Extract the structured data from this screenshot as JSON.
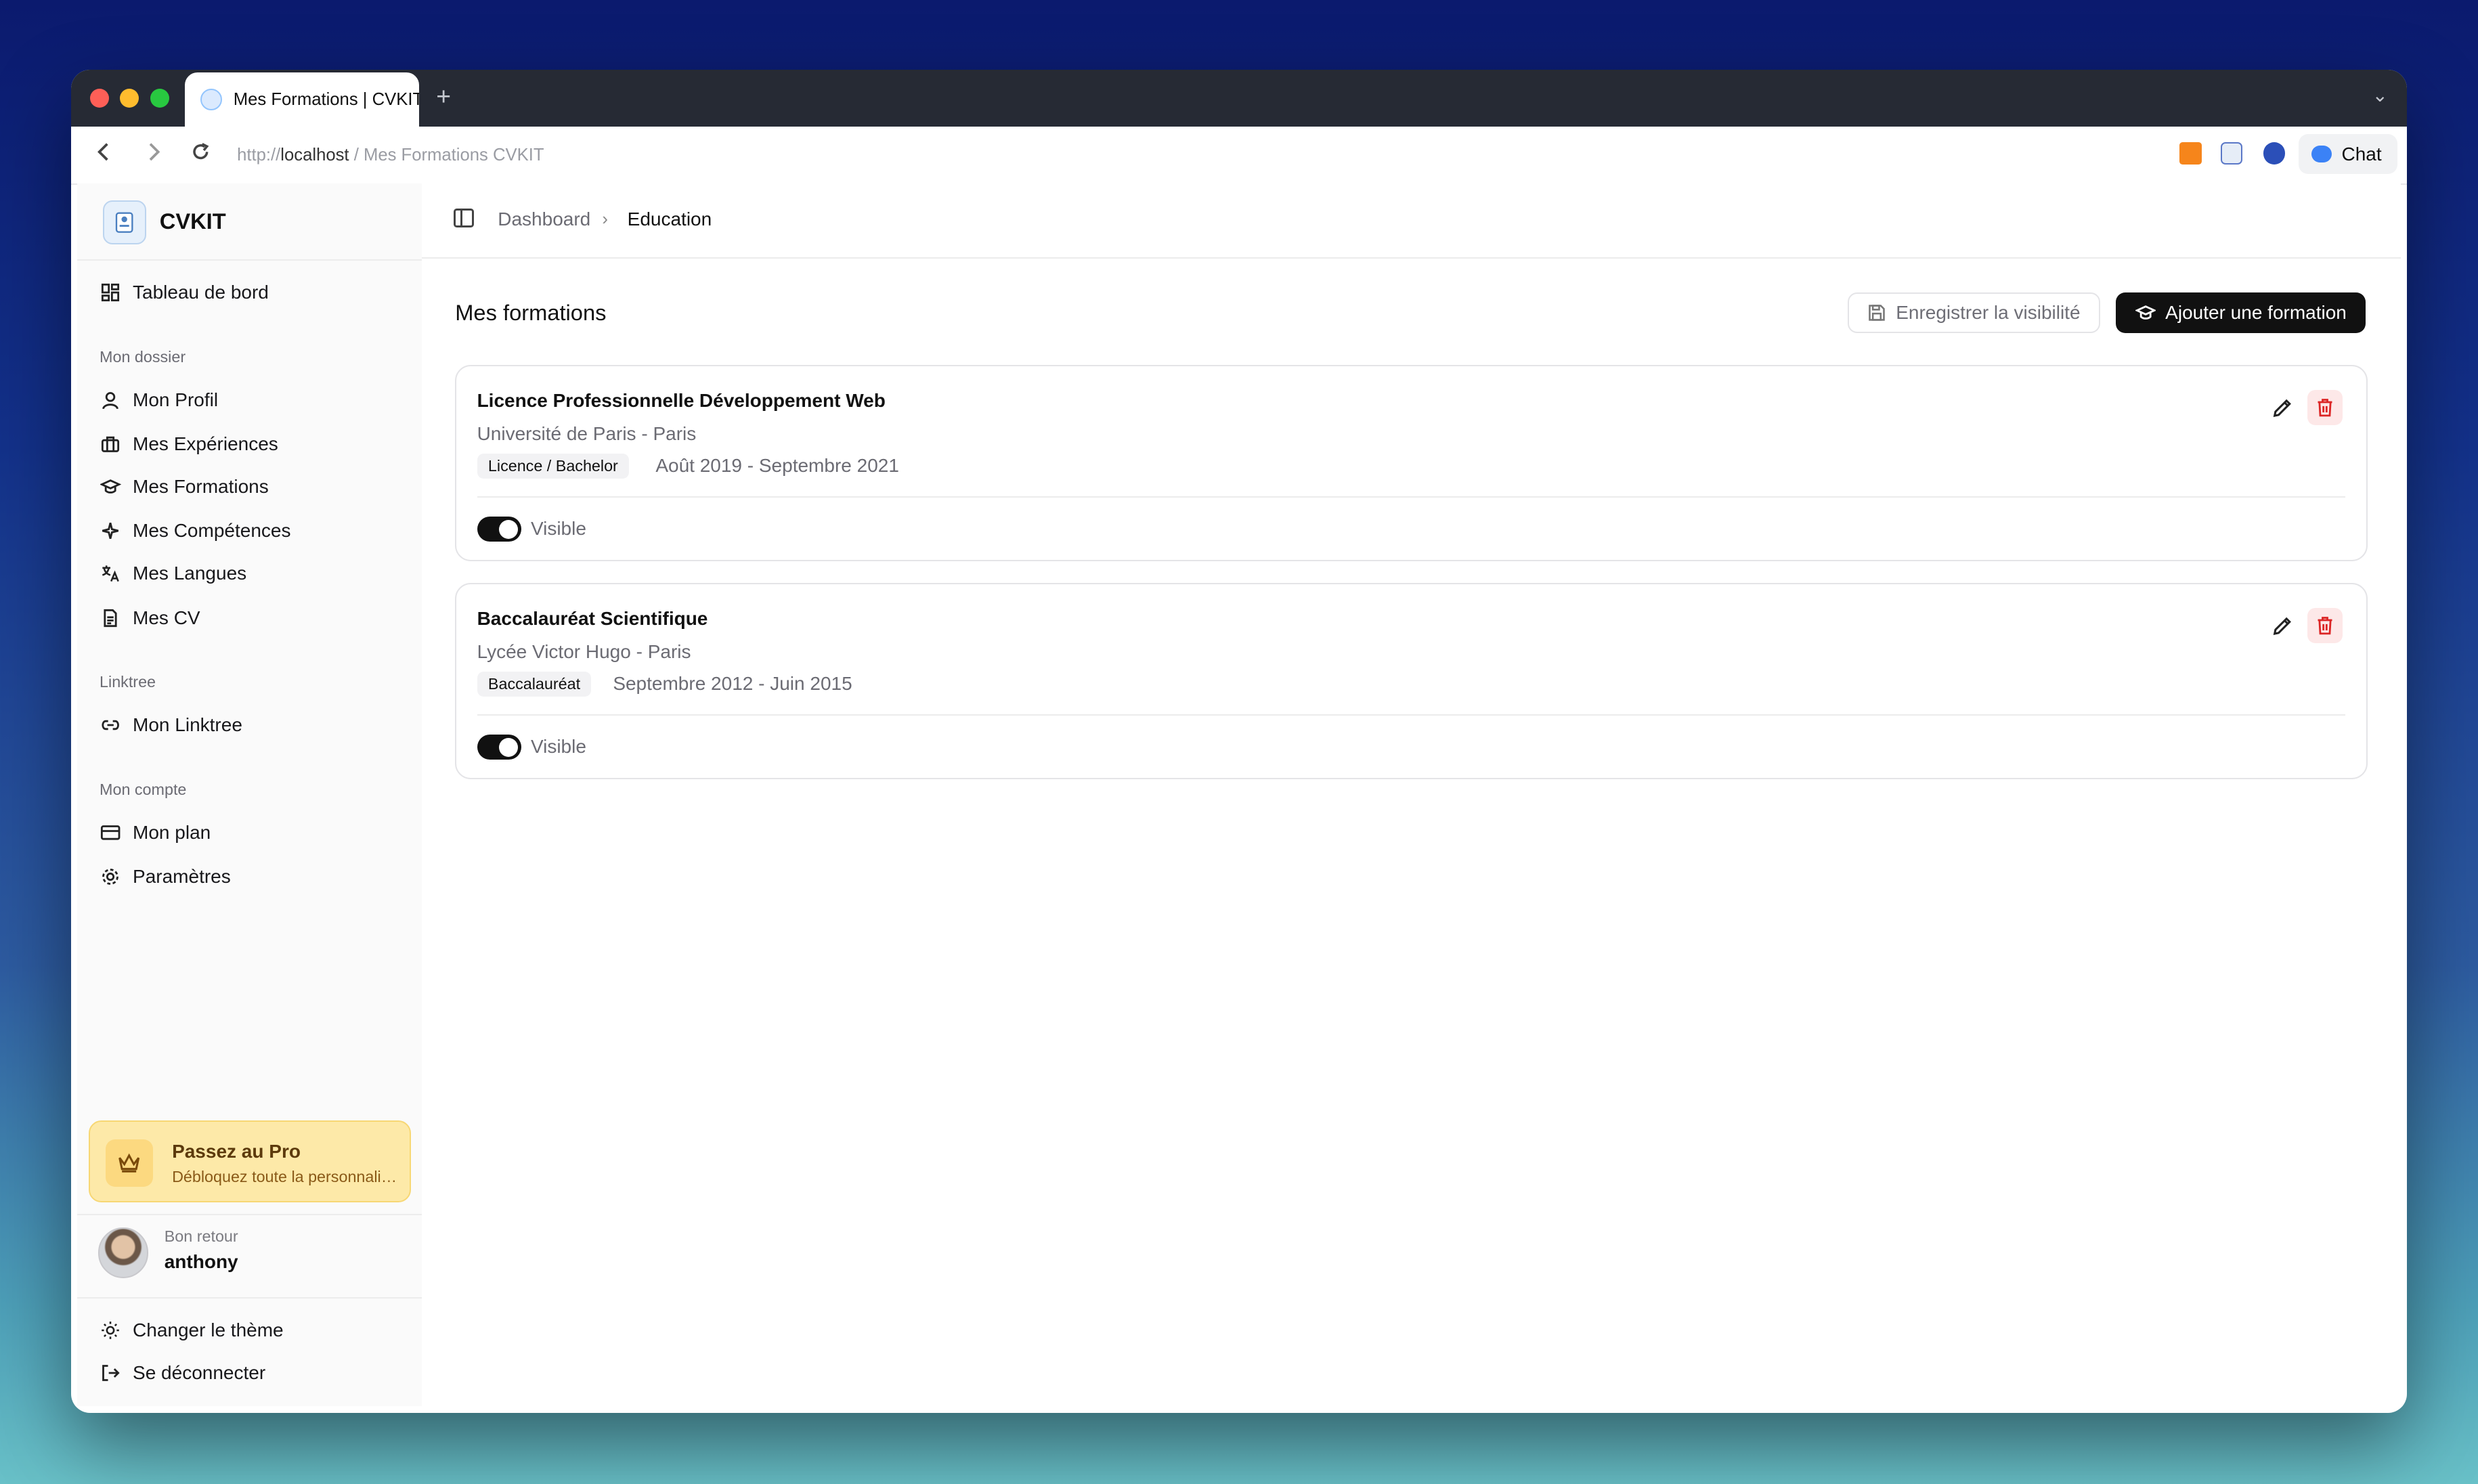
{
  "browser": {
    "tab_title": "Mes Formations | CVKIT",
    "url_scheme": "http://",
    "url_host": "localhost",
    "url_rest": " / Mes Formations CVKIT",
    "chat_label": "Chat"
  },
  "sidebar": {
    "brand": "CVKIT",
    "dashboard": "Tableau de bord",
    "section_dossier": "Mon dossier",
    "profil": "Mon Profil",
    "experiences": "Mes Expériences",
    "formations": "Mes Formations",
    "competences": "Mes Compétences",
    "langues": "Mes Langues",
    "cv": "Mes CV",
    "section_linktree": "Linktree",
    "linktree": "Mon Linktree",
    "section_compte": "Mon compte",
    "plan": "Mon plan",
    "parametres": "Paramètres",
    "promo_title": "Passez au Pro",
    "promo_text": "Débloquez toute la personnalisation",
    "user_greeting": "Bon retour",
    "user_name": "anthony",
    "theme": "Changer le thème",
    "logout": "Se déconnecter"
  },
  "breadcrumb": {
    "parent": "Dashboard",
    "current": "Education"
  },
  "main": {
    "title": "Mes formations",
    "save_visibility": "Enregistrer la visibilité",
    "add_formation": "Ajouter une formation"
  },
  "formations": [
    {
      "title": "Licence Professionnelle Développement Web",
      "school": "Université de Paris - Paris",
      "degree": "Licence / Bachelor",
      "dates": "Août 2019 - Septembre 2021",
      "visibility_label": "Visible",
      "visible": true
    },
    {
      "title": "Baccalauréat Scientifique",
      "school": "Lycée Victor Hugo - Paris",
      "degree": "Baccalauréat",
      "dates": "Septembre 2012 - Juin 2015",
      "visibility_label": "Visible",
      "visible": true
    }
  ],
  "colors": {
    "accent": "#111111",
    "danger": "#dc2626",
    "promo_bg": "#fde9a8"
  }
}
